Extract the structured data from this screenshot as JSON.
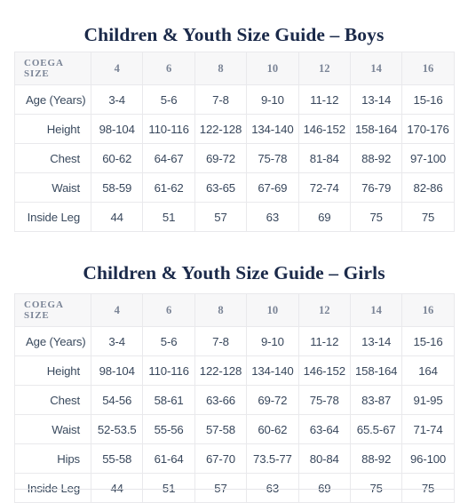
{
  "page": {
    "background": "#ffffff",
    "title_color": "#1b2a4a",
    "header_bg": "#f7f7f8",
    "header_text_color": "#7a8496",
    "border_color": "#e9e9ec",
    "body_text_color": "#38475c"
  },
  "boys": {
    "title": "Children & Youth Size Guide – Boys",
    "header": {
      "label": "COEGA SIZE",
      "sizes": [
        "4",
        "6",
        "8",
        "10",
        "12",
        "14",
        "16"
      ]
    },
    "rows": [
      {
        "label": "Age (Years)",
        "values": [
          "3-4",
          "5-6",
          "7-8",
          "9-10",
          "11-12",
          "13-14",
          "15-16"
        ]
      },
      {
        "label": "Height",
        "values": [
          "98-104",
          "110-116",
          "122-128",
          "134-140",
          "146-152",
          "158-164",
          "170-176"
        ]
      },
      {
        "label": "Chest",
        "values": [
          "60-62",
          "64-67",
          "69-72",
          "75-78",
          "81-84",
          "88-92",
          "97-100"
        ]
      },
      {
        "label": "Waist",
        "values": [
          "58-59",
          "61-62",
          "63-65",
          "67-69",
          "72-74",
          "76-79",
          "82-86"
        ]
      },
      {
        "label": "Inside Leg",
        "values": [
          "44",
          "51",
          "57",
          "63",
          "69",
          "75",
          "75"
        ]
      }
    ]
  },
  "girls": {
    "title": "Children & Youth Size Guide – Girls",
    "header": {
      "label": "COEGA SIZE",
      "sizes": [
        "4",
        "6",
        "8",
        "10",
        "12",
        "14",
        "16"
      ]
    },
    "rows": [
      {
        "label": "Age (Years)",
        "values": [
          "3-4",
          "5-6",
          "7-8",
          "9-10",
          "11-12",
          "13-14",
          "15-16"
        ]
      },
      {
        "label": "Height",
        "values": [
          "98-104",
          "110-116",
          "122-128",
          "134-140",
          "146-152",
          "158-164",
          "164"
        ]
      },
      {
        "label": "Chest",
        "values": [
          "54-56",
          "58-61",
          "63-66",
          "69-72",
          "75-78",
          "83-87",
          "91-95"
        ]
      },
      {
        "label": "Waist",
        "values": [
          "52-53.5",
          "55-56",
          "57-58",
          "60-62",
          "63-64",
          "65.5-67",
          "71-74"
        ]
      },
      {
        "label": "Hips",
        "values": [
          "55-58",
          "61-64",
          "67-70",
          "73.5-77",
          "80-84",
          "88-92",
          "96-100"
        ]
      },
      {
        "label": "Inside Leg",
        "values": [
          "44",
          "51",
          "57",
          "63",
          "69",
          "75",
          "75"
        ]
      }
    ]
  }
}
